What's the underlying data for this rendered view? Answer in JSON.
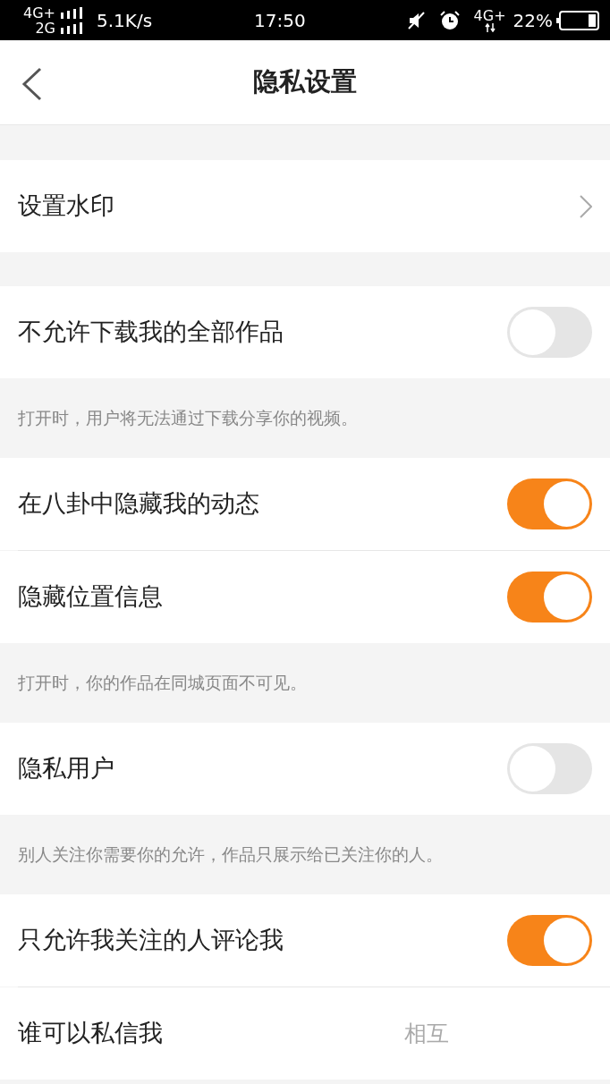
{
  "status_bar": {
    "network_top": "4G+",
    "network_bottom": "2G",
    "speed": "5.1K/s",
    "time": "17:50",
    "mobile_data": "4G+",
    "battery": "22%"
  },
  "header": {
    "title": "隐私设置"
  },
  "sections": [
    {
      "rows": [
        {
          "kind": "link",
          "label": "设置水印"
        }
      ]
    },
    {
      "rows": [
        {
          "kind": "toggle",
          "label": "不允许下载我的全部作品",
          "on": false
        }
      ],
      "note": "打开时，用户将无法通过下载分享你的视频。"
    },
    {
      "rows": [
        {
          "kind": "toggle",
          "label": "在八卦中隐藏我的动态",
          "on": true
        },
        {
          "kind": "toggle",
          "label": "隐藏位置信息",
          "on": true
        }
      ],
      "note": "打开时，你的作品在同城页面不可见。"
    },
    {
      "rows": [
        {
          "kind": "toggle",
          "label": "隐私用户",
          "on": false
        }
      ],
      "note": "别人关注你需要你的允许，作品只展示给已关注你的人。"
    },
    {
      "rows": [
        {
          "kind": "toggle",
          "label": "只允许我关注的人评论我",
          "on": true
        },
        {
          "kind": "value",
          "label": "谁可以私信我",
          "value": "相互"
        }
      ]
    }
  ]
}
